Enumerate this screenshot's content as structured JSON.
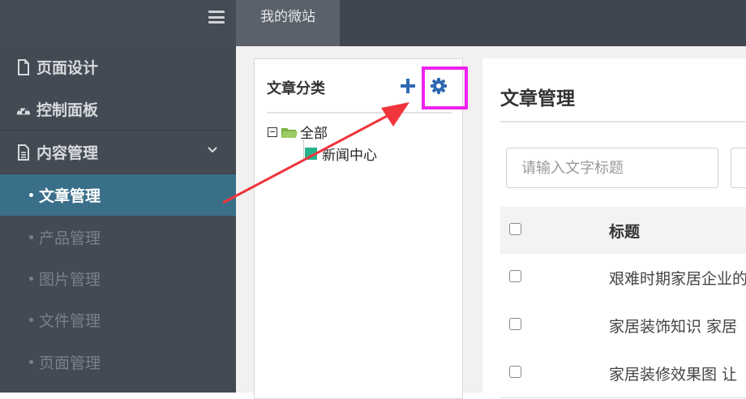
{
  "topbar": {
    "tab_label": "我的微站",
    "hamburger_icon": "hamburger-menu-icon"
  },
  "sidebar": {
    "items": [
      {
        "label": "页面设计",
        "icon": "file-icon"
      },
      {
        "label": "控制面板",
        "icon": "dashboard-icon"
      },
      {
        "label": "内容管理",
        "icon": "document-icon",
        "expanded": true
      }
    ],
    "subitems": [
      {
        "label": "文章管理",
        "active": true
      },
      {
        "label": "产品管理"
      },
      {
        "label": "图片管理"
      },
      {
        "label": "文件管理"
      },
      {
        "label": "页面管理"
      }
    ],
    "active_color": "#3a6f8a"
  },
  "category_panel": {
    "title": "文章分类",
    "add_icon": "plus-icon",
    "settings_icon": "gear-icon",
    "tree": {
      "root": "全部",
      "children": [
        "新闻中心"
      ]
    }
  },
  "content": {
    "title": "文章管理",
    "search_placeholder": "请输入文字标题",
    "table": {
      "header": "标题",
      "rows": [
        "艰难时期家居企业的",
        "家居装饰知识 家居",
        "家居装修效果图 让"
      ]
    }
  },
  "annotation": {
    "highlight_color": "#ee22ee",
    "arrow_color": "#f0353c"
  }
}
